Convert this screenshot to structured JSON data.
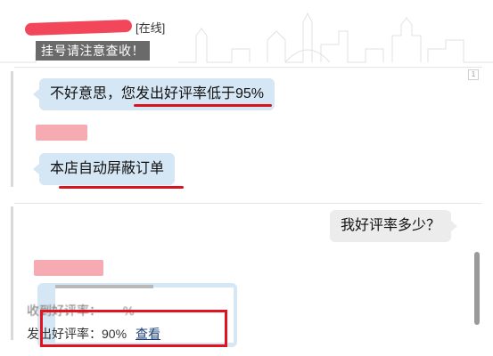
{
  "header": {
    "contact_status": "[在线]",
    "notice": "挂号请注意查收！"
  },
  "panel_top": {
    "scroll_number": "1"
  },
  "messages": [
    {
      "side": "left",
      "text": "不好意思，您发出好评率低于95%"
    },
    {
      "side": "left",
      "text": "本店自动屏蔽订单"
    },
    {
      "side": "right",
      "text": "我好评率多少？"
    }
  ],
  "rating_card": {
    "received_label": "收到好评率：",
    "received_value": "%",
    "sent_label": "发出好评率：",
    "sent_value": "90%",
    "view_link": "查看"
  },
  "colors": {
    "bubble_left": "#d5e6f4",
    "bubble_right": "#ececec",
    "highlight_red": "#e0131f",
    "notice_bg": "#6a6a6a"
  }
}
